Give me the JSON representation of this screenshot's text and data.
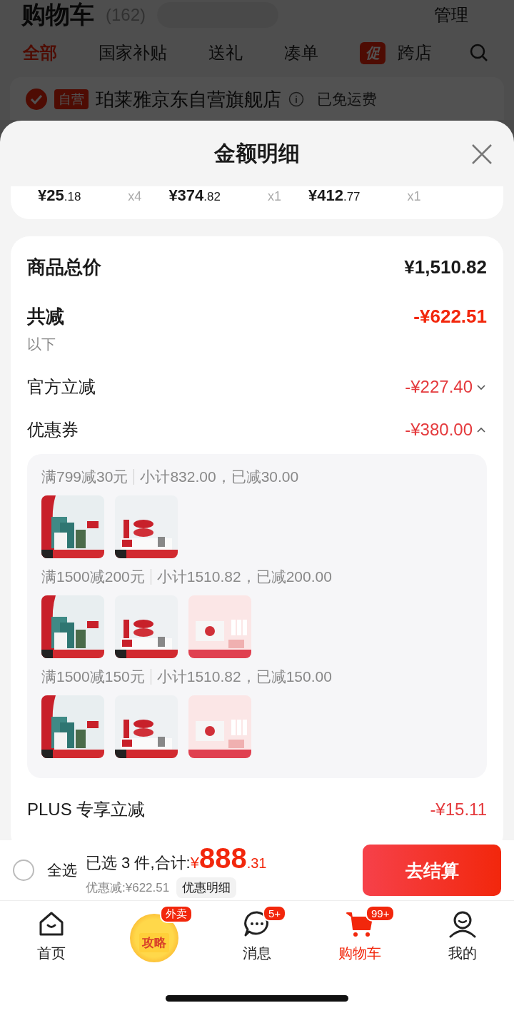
{
  "background": {
    "title": "购物车",
    "count": "(162)",
    "manage": "管理",
    "tabs": [
      {
        "label": "全部",
        "selected": true
      },
      {
        "label": "国家补贴",
        "selected": false
      },
      {
        "label": "送礼",
        "selected": false
      },
      {
        "label": "凑单",
        "selected": false
      },
      {
        "label": "跨店",
        "selected": false,
        "badge": "促"
      }
    ],
    "store": {
      "checked": true,
      "tag": "自营",
      "name": "珀莱雅京东自营旗舰店",
      "shipping": "已免运费"
    }
  },
  "sheet": {
    "title": "金额明细",
    "items": [
      {
        "price": "¥25",
        "cents": ".18",
        "qty": "x4"
      },
      {
        "price": "¥374",
        "cents": ".82",
        "qty": "x1"
      },
      {
        "price": "¥412",
        "cents": ".77",
        "qty": "x1"
      }
    ],
    "total_label": "商品总价",
    "total": "¥1,510.82",
    "reduction_label": "共减",
    "reduction": "-¥622.51",
    "note": "以下",
    "discounts": [
      {
        "kind": "collapsible",
        "label": "官方立减",
        "amount": "-¥227.40",
        "expanded": false
      },
      {
        "kind": "collapsible",
        "label": "优惠券",
        "amount": "-¥380.00",
        "expanded": true,
        "coupons": [
          {
            "rule": "满799减30元",
            "detail": "小计832.00，已减30.00"
          },
          {
            "rule": "满1500减200元",
            "detail": "小计1510.82，已减200.00"
          },
          {
            "rule": "满1500减150元",
            "detail": "小计1510.82，已减150.00"
          }
        ]
      },
      {
        "kind": "plain",
        "label": "PLUS 专享立减",
        "amount": "-¥15.11"
      }
    ]
  },
  "footer": {
    "select_all": {
      "label": "全选",
      "checked": false
    },
    "summary": "已选 3 件,合计:",
    "currency": "¥",
    "amount": "888",
    "cents": ".31",
    "discount": "优惠减:¥622.51",
    "detail_button": "优惠明细",
    "checkout": "去结算"
  },
  "nav": [
    {
      "kind": "home",
      "label": "首页",
      "selected": false
    },
    {
      "kind": "promo",
      "art_text": "攻略",
      "badge": "外卖",
      "selected": false
    },
    {
      "kind": "message",
      "label": "消息",
      "badge": "5+",
      "selected": false
    },
    {
      "kind": "cart",
      "label": "购物车",
      "badge": "99+",
      "selected": true
    },
    {
      "kind": "profile",
      "label": "我的",
      "selected": false
    }
  ]
}
